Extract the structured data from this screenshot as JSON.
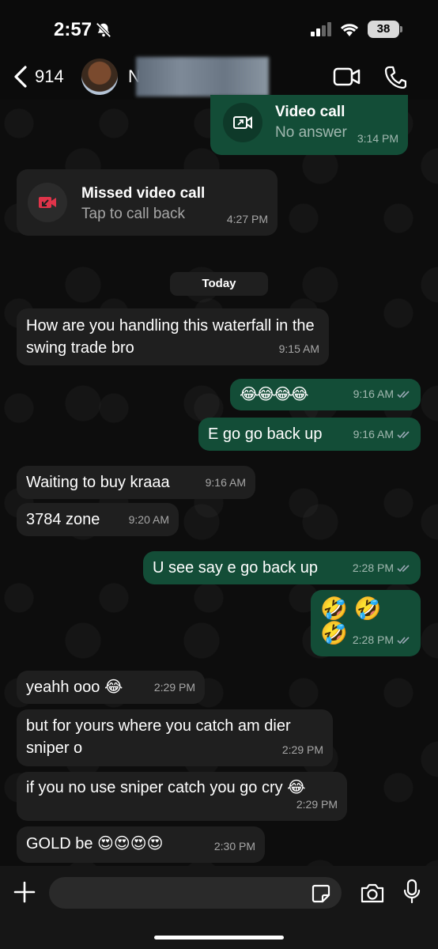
{
  "status_bar": {
    "time": "2:57",
    "battery": "38"
  },
  "header": {
    "back_count": "914",
    "contact_initial": "N"
  },
  "call_events": [
    {
      "title": "Video call",
      "subtitle": "No answer",
      "time": "3:14 PM"
    },
    {
      "title": "Missed video call",
      "subtitle": "Tap to call back",
      "time": "4:27 PM"
    }
  ],
  "date_divider": "Today",
  "messages": [
    {
      "dir": "in",
      "text": "How are you handling this waterfall in the swing trade bro",
      "time": "9:15 AM"
    },
    {
      "dir": "out",
      "text": "😂😂😂😂",
      "time": "9:16 AM"
    },
    {
      "dir": "out",
      "text": "E go go back up",
      "time": "9:16 AM"
    },
    {
      "dir": "in",
      "text": "Waiting to buy kraaa",
      "time": "9:16 AM"
    },
    {
      "dir": "in",
      "text": "3784 zone",
      "time": "9:20 AM"
    },
    {
      "dir": "out",
      "text": "U see say e go back up",
      "time": "2:28 PM"
    },
    {
      "dir": "out",
      "text": "🤣 🤣 🤣",
      "time": "2:28 PM"
    },
    {
      "dir": "in",
      "text": "yeahh ooo 😂",
      "time": "2:29 PM"
    },
    {
      "dir": "in",
      "text": "but for yours where you catch am dier sniper o",
      "time": "2:29 PM"
    },
    {
      "dir": "in",
      "text": "if you no use sniper catch you go cry 😂",
      "time": "2:29 PM"
    },
    {
      "dir": "in",
      "text": "GOLD be 😍😍😍😍",
      "time": "2:30 PM"
    }
  ],
  "composer": {
    "placeholder": ""
  },
  "icons": {
    "back": "chevron-left-icon",
    "video": "video-camera-icon",
    "phone": "phone-icon",
    "plus": "plus-icon",
    "sticker": "sticker-icon",
    "camera": "camera-icon",
    "mic": "microphone-icon"
  },
  "colors": {
    "incoming": "#1f1f1f",
    "outgoing": "#134d37",
    "missed": "#e0344a",
    "tick": "#9aa8b5"
  }
}
